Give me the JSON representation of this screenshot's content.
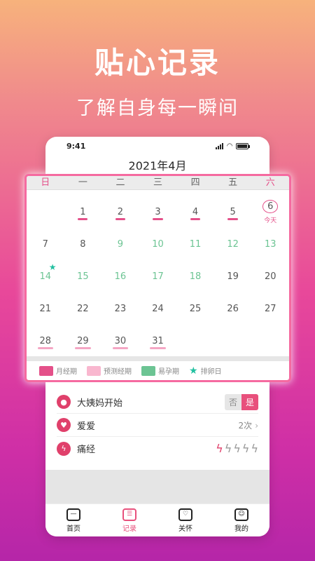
{
  "promo": {
    "headline": "贴心记录",
    "subline": "了解自身每一瞬间"
  },
  "status_bar": {
    "time": "9:41"
  },
  "calendar": {
    "month_title": "2021年4月",
    "weekdays": [
      "日",
      "一",
      "二",
      "三",
      "四",
      "五",
      "六"
    ],
    "today_label": "今天",
    "rows": [
      [
        {
          "d": "",
          "type": ""
        },
        {
          "d": "1",
          "type": "period"
        },
        {
          "d": "2",
          "type": "period"
        },
        {
          "d": "3",
          "type": "period"
        },
        {
          "d": "4",
          "type": "period"
        },
        {
          "d": "5",
          "type": "period"
        },
        {
          "d": "6",
          "type": "today"
        }
      ],
      [
        {
          "d": "7",
          "type": ""
        },
        {
          "d": "8",
          "type": ""
        },
        {
          "d": "9",
          "type": "fertile"
        },
        {
          "d": "10",
          "type": "fertile"
        },
        {
          "d": "11",
          "type": "fertile"
        },
        {
          "d": "12",
          "type": "fertile"
        },
        {
          "d": "13",
          "type": "fertile"
        }
      ],
      [
        {
          "d": "14",
          "type": "fertile-ovulation"
        },
        {
          "d": "15",
          "type": "fertile"
        },
        {
          "d": "16",
          "type": "fertile"
        },
        {
          "d": "17",
          "type": "fertile"
        },
        {
          "d": "18",
          "type": "fertile"
        },
        {
          "d": "19",
          "type": ""
        },
        {
          "d": "20",
          "type": ""
        }
      ],
      [
        {
          "d": "21",
          "type": ""
        },
        {
          "d": "22",
          "type": ""
        },
        {
          "d": "23",
          "type": ""
        },
        {
          "d": "24",
          "type": ""
        },
        {
          "d": "25",
          "type": ""
        },
        {
          "d": "26",
          "type": ""
        },
        {
          "d": "27",
          "type": ""
        }
      ],
      [
        {
          "d": "28",
          "type": "predicted"
        },
        {
          "d": "29",
          "type": "predicted"
        },
        {
          "d": "30",
          "type": "predicted"
        },
        {
          "d": "31",
          "type": "predicted"
        },
        {
          "d": "",
          "type": ""
        },
        {
          "d": "",
          "type": ""
        },
        {
          "d": "",
          "type": ""
        }
      ]
    ],
    "legend": [
      {
        "label": "月经期",
        "color": "#e45089"
      },
      {
        "label": "预测经期",
        "color": "#f9b7cf"
      },
      {
        "label": "易孕期",
        "color": "#6cc493"
      },
      {
        "label": "排卵日",
        "icon": "star-icon",
        "color": "#22c0a0"
      }
    ]
  },
  "records": {
    "period_start": {
      "label": "大姨妈开始",
      "no": "否",
      "yes": "是"
    },
    "love": {
      "label": "爱爱",
      "value": "2次"
    },
    "cramps": {
      "label": "痛经",
      "level": 1,
      "max": 5
    }
  },
  "tabbar": [
    {
      "label": "首页",
      "icon": "home-icon",
      "active": false
    },
    {
      "label": "记录",
      "icon": "record-icon",
      "active": true
    },
    {
      "label": "关怀",
      "icon": "care-icon",
      "active": false
    },
    {
      "label": "我的",
      "icon": "profile-icon",
      "active": false
    }
  ],
  "colors": {
    "accent": "#e8507c",
    "fertile": "#6cc493",
    "ovulation": "#22c0a0"
  }
}
